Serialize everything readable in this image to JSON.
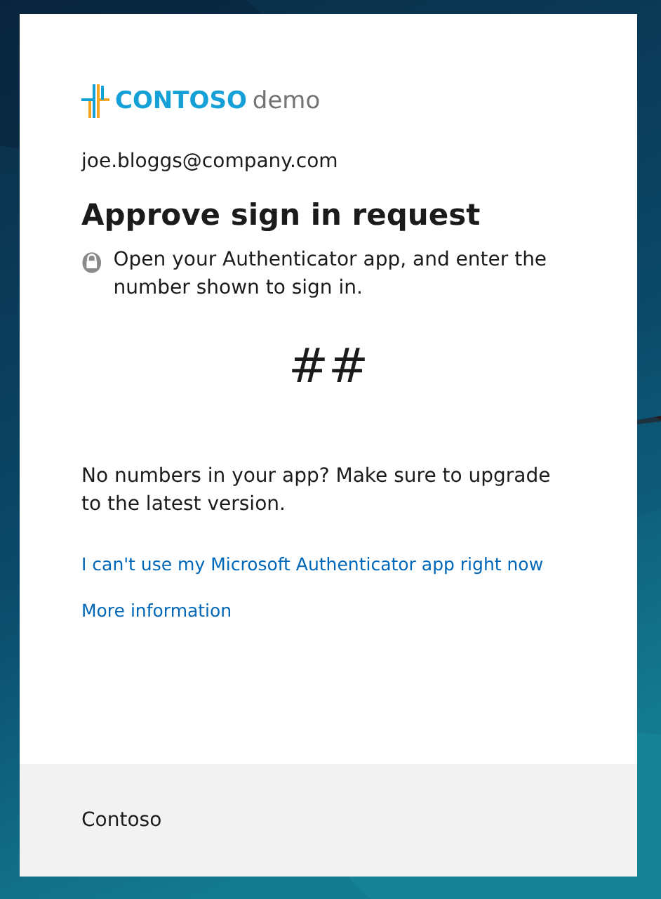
{
  "logo": {
    "brand": "CONTOSO",
    "suffix": "demo"
  },
  "account": "joe.bloggs@company.com",
  "title": "Approve sign in request",
  "instruction": "Open your Authenticator app, and enter the number shown to sign in.",
  "number": "##",
  "note": "No numbers in your app? Make sure to upgrade to the latest version.",
  "links": [
    "I can't use my Microsoft Authenticator app right now",
    "More information"
  ],
  "footer": "Contoso"
}
